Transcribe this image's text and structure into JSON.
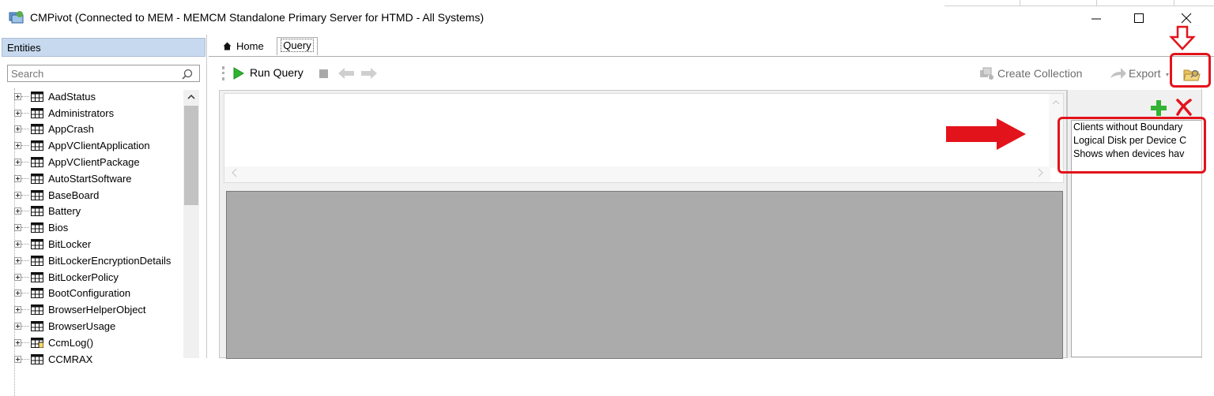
{
  "window": {
    "title": "CMPivot (Connected to MEM - MEMCM Standalone Primary Server for HTMD - All Systems)",
    "minimize": "—",
    "maximize": "☐",
    "close": "✕"
  },
  "entities": {
    "header": "Entities",
    "search_placeholder": "Search",
    "items": [
      {
        "label": "AadStatus",
        "icon": "table-icon"
      },
      {
        "label": "Administrators",
        "icon": "table-icon"
      },
      {
        "label": "AppCrash",
        "icon": "table-icon"
      },
      {
        "label": "AppVClientApplication",
        "icon": "table-icon"
      },
      {
        "label": "AppVClientPackage",
        "icon": "table-icon"
      },
      {
        "label": "AutoStartSoftware",
        "icon": "table-icon"
      },
      {
        "label": "BaseBoard",
        "icon": "table-icon"
      },
      {
        "label": "Battery",
        "icon": "table-icon"
      },
      {
        "label": "Bios",
        "icon": "table-icon"
      },
      {
        "label": "BitLocker",
        "icon": "table-icon"
      },
      {
        "label": "BitLockerEncryptionDetails",
        "icon": "table-icon"
      },
      {
        "label": "BitLockerPolicy",
        "icon": "table-icon"
      },
      {
        "label": "BootConfiguration",
        "icon": "table-icon"
      },
      {
        "label": "BrowserHelperObject",
        "icon": "table-icon"
      },
      {
        "label": "BrowserUsage",
        "icon": "table-icon"
      },
      {
        "label": "CcmLog()",
        "icon": "table-function-icon"
      },
      {
        "label": "CCMRAX",
        "icon": "table-icon"
      }
    ]
  },
  "tabs": [
    {
      "label": "Home",
      "icon": "home-icon"
    },
    {
      "label": "Query",
      "selected": true
    }
  ],
  "toolbar": {
    "run_query": "Run Query",
    "create_collection": "Create Collection",
    "export": "Export",
    "export_caret": "▾",
    "disabled_color": "#6d6d6d"
  },
  "favorites": {
    "items": [
      "Clients without Boundary",
      "Logical Disk per Device C",
      "Shows when devices hav"
    ]
  },
  "colors": {
    "annotation_red": "#e3131b",
    "entities_header_bg": "#c7d9ee",
    "results_bg": "#ababab",
    "play_green": "#2db52d"
  }
}
